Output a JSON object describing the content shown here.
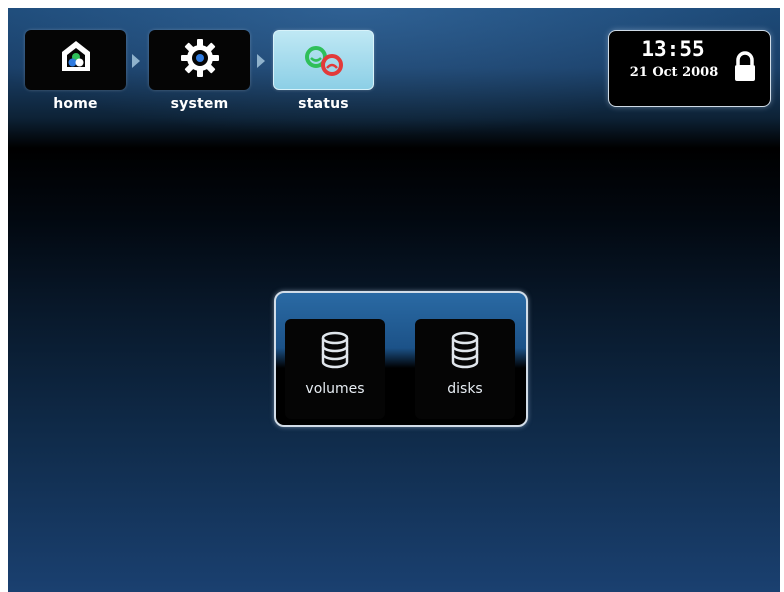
{
  "breadcrumb": {
    "items": [
      {
        "label": "home",
        "icon": "home-icon"
      },
      {
        "label": "system",
        "icon": "gear-icon"
      },
      {
        "label": "status",
        "icon": "status-icon"
      }
    ],
    "active": "status"
  },
  "clock": {
    "time": "13:55",
    "date": "21 Oct 2008",
    "icon": "lock-icon"
  },
  "panel": {
    "tiles": [
      {
        "label": "volumes",
        "icon": "database-icon"
      },
      {
        "label": "disks",
        "icon": "database-icon"
      }
    ]
  },
  "colors": {
    "accent_active": "#9fd9ec",
    "background_top": "#1d4a78",
    "background_bottom": "#1a4070",
    "status_green": "#2fbf5a",
    "status_red": "#e23a3a"
  }
}
